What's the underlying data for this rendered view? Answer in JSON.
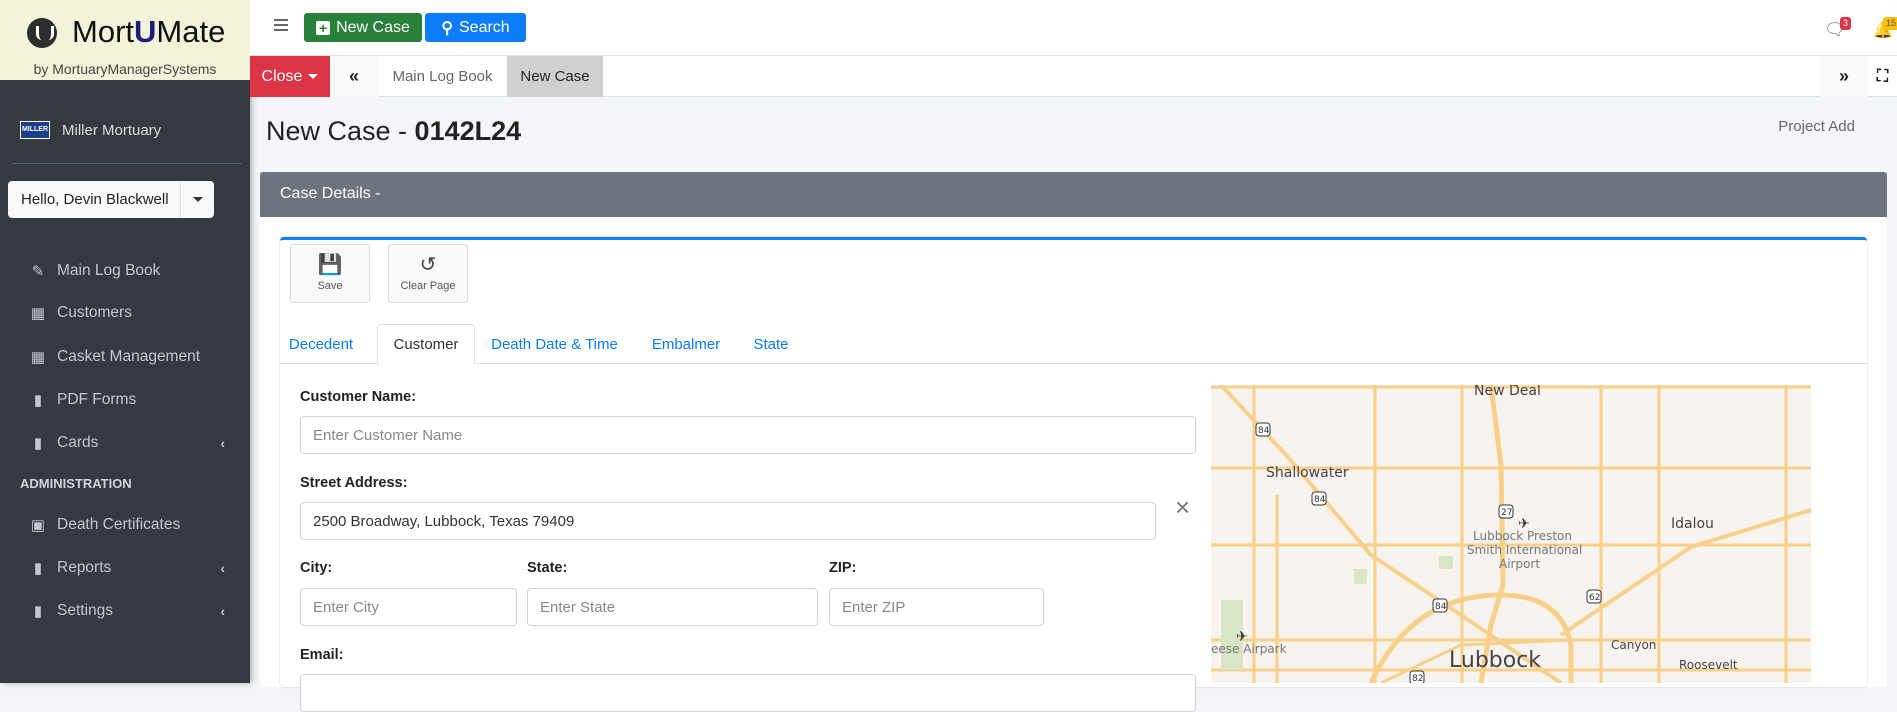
{
  "brand": {
    "name_pre": "Mort",
    "name_mid": "U",
    "name_post": "Mate",
    "subtitle": "by MortuaryManagerSystems"
  },
  "org": {
    "name": "Miller Mortuary",
    "logo_text": "MILLER"
  },
  "user": {
    "greeting": "Hello, Devin Blackwell"
  },
  "sidebar": {
    "items": [
      {
        "label": "Main Log Book",
        "icon": "pencil-icon"
      },
      {
        "label": "Customers",
        "icon": "building-icon"
      },
      {
        "label": "Casket Management",
        "icon": "building-icon"
      },
      {
        "label": "PDF Forms",
        "icon": "file-icon"
      },
      {
        "label": "Cards",
        "icon": "file-pdf-icon"
      }
    ],
    "section": "ADMINISTRATION",
    "admin_items": [
      {
        "label": "Death Certificates",
        "icon": "certificate-icon"
      },
      {
        "label": "Reports",
        "icon": "file-pdf-icon"
      },
      {
        "label": "Settings",
        "icon": "file-pdf-icon"
      }
    ]
  },
  "topbar": {
    "new_case": "New Case",
    "search": "Search",
    "messages_count": "3",
    "notifications_count": "15"
  },
  "tabbar": {
    "close": "Close",
    "tabs": [
      "Main Log Book",
      "New Case"
    ]
  },
  "page": {
    "title_prefix": "New Case - ",
    "case_number": "0142L24",
    "project_add": "Project Add"
  },
  "card": {
    "header": "Case Details -",
    "save": "Save",
    "clear": "Clear Page",
    "tabs": [
      "Decedent",
      "Customer",
      "Death Date & Time",
      "Embalmer",
      "State"
    ],
    "active_tab": "Customer"
  },
  "form": {
    "customer_name": {
      "label": "Customer Name:",
      "value": "",
      "placeholder": "Enter Customer Name"
    },
    "street": {
      "label": "Street Address:",
      "value": "2500 Broadway, Lubbock, Texas 79409"
    },
    "city": {
      "label": "City:",
      "placeholder": "Enter City"
    },
    "state": {
      "label": "State:",
      "placeholder": "Enter State"
    },
    "zip": {
      "label": "ZIP:",
      "placeholder": "Enter ZIP"
    },
    "email": {
      "label": "Email:"
    }
  },
  "map": {
    "labels": [
      "New Deal",
      "Shallowater",
      "Lubbock Preston",
      "Smith International",
      "Airport",
      "Idalou",
      "Canyon",
      "Roosevelt",
      "Lubbock",
      "eese Airpark"
    ],
    "shields": [
      "84",
      "84",
      "27",
      "84",
      "62",
      "82"
    ]
  }
}
